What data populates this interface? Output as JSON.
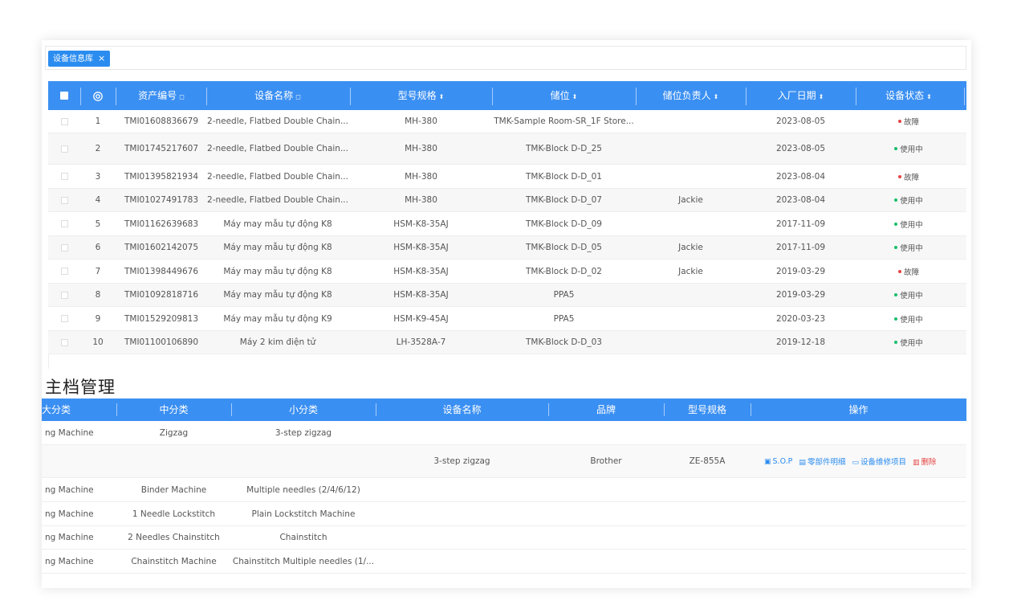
{
  "tabs": [
    {
      "label": "设备信息库",
      "close": "×"
    }
  ],
  "colors": {
    "header": "#3a8ff2",
    "tab": "#2b8cf0",
    "fault": "#e64242",
    "in_use": "#19be6b"
  },
  "table1": {
    "headers": {
      "asset_no": "资产编号",
      "name": "设备名称",
      "model": "型号规格",
      "location": "储位",
      "owner": "储位负责人",
      "date": "入厂日期",
      "status": "设备状态"
    },
    "rows": [
      {
        "idx": "1",
        "asset_no": "TMI01608836679",
        "name": "2-needle, Flatbed Double Chain...",
        "model": "MH-380",
        "location": "TMK-Sample Room-SR_1F Store...",
        "owner": "",
        "date": "2023-08-05",
        "status": "故障",
        "status_type": "fault"
      },
      {
        "idx": "2",
        "asset_no": "TMI01745217607",
        "name": "2-needle, Flatbed Double Chain...",
        "model": "MH-380",
        "location": "TMK-Block D-D_25",
        "owner": "",
        "date": "2023-08-05",
        "status": "使用中",
        "status_type": "in_use"
      },
      {
        "idx": "3",
        "asset_no": "TMI01395821934",
        "name": "2-needle, Flatbed Double Chain...",
        "model": "MH-380",
        "location": "TMK-Block D-D_01",
        "owner": "",
        "date": "2023-08-04",
        "status": "故障",
        "status_type": "fault"
      },
      {
        "idx": "4",
        "asset_no": "TMI01027491783",
        "name": "2-needle, Flatbed Double Chain...",
        "model": "MH-380",
        "location": "TMK-Block D-D_07",
        "owner": "Jackie",
        "date": "2023-08-04",
        "status": "使用中",
        "status_type": "in_use"
      },
      {
        "idx": "5",
        "asset_no": "TMI01162639683",
        "name": "Máy may mẫu tự động K8",
        "model": "HSM-K8-35AJ",
        "location": "TMK-Block D-D_09",
        "owner": "",
        "date": "2017-11-09",
        "status": "使用中",
        "status_type": "in_use"
      },
      {
        "idx": "6",
        "asset_no": "TMI01602142075",
        "name": "Máy may mẫu tự động K8",
        "model": "HSM-K8-35AJ",
        "location": "TMK-Block D-D_05",
        "owner": "Jackie",
        "date": "2017-11-09",
        "status": "使用中",
        "status_type": "in_use"
      },
      {
        "idx": "7",
        "asset_no": "TMI01398449676",
        "name": "Máy may mẫu tự động K8",
        "model": "HSM-K8-35AJ",
        "location": "TMK-Block D-D_02",
        "owner": "Jackie",
        "date": "2019-03-29",
        "status": "故障",
        "status_type": "fault"
      },
      {
        "idx": "8",
        "asset_no": "TMI01092818716",
        "name": "Máy may mẫu tự động K8",
        "model": "HSM-K8-35AJ",
        "location": "PPA5",
        "owner": "",
        "date": "2019-03-29",
        "status": "使用中",
        "status_type": "in_use"
      },
      {
        "idx": "9",
        "asset_no": "TMI01529209813",
        "name": "Máy may mẫu tự động K9",
        "model": "HSM-K9-45AJ",
        "location": "PPA5",
        "owner": "",
        "date": "2020-03-23",
        "status": "使用中",
        "status_type": "in_use"
      },
      {
        "idx": "10",
        "asset_no": "TMI01100106890",
        "name": "Máy 2 kim điện tử",
        "model": "LH-3528A-7",
        "location": "TMK-Block D-D_03",
        "owner": "",
        "date": "2019-12-18",
        "status": "使用中",
        "status_type": "in_use"
      }
    ]
  },
  "section_title": "主档管理",
  "table2": {
    "headers": {
      "major": "大分类",
      "mid": "中分类",
      "minor": "小分类",
      "name": "设备名称",
      "brand": "品牌",
      "model": "型号规格",
      "ops": "操作"
    },
    "ops": {
      "sop": "S.O.P",
      "parts": "零部件明细",
      "repair": "设备维修项目",
      "delete": "删除"
    },
    "rows": [
      {
        "major": "ng Machine",
        "mid": "Zigzag",
        "minor": "3-step zigzag",
        "name": "",
        "brand": "",
        "model": "",
        "has_ops": false
      },
      {
        "major": "",
        "mid": "",
        "minor": "",
        "name": "3-step zigzag",
        "brand": "Brother",
        "model": "ZE-855A",
        "has_ops": true
      },
      {
        "major": "ng Machine",
        "mid": "Binder Machine",
        "minor": "Multiple needles (2/4/6/12)",
        "name": "",
        "brand": "",
        "model": "",
        "has_ops": false
      },
      {
        "major": "ng Machine",
        "mid": "1 Needle Lockstitch",
        "minor": "Plain Lockstitch Machine",
        "name": "",
        "brand": "",
        "model": "",
        "has_ops": false
      },
      {
        "major": "ng Machine",
        "mid": "2 Needles Chainstitch",
        "minor": "Chainstitch",
        "name": "",
        "brand": "",
        "model": "",
        "has_ops": false
      },
      {
        "major": "ng Machine",
        "mid": "Chainstitch Machine",
        "minor": "Chainstitch Multiple needles (1/...",
        "name": "",
        "brand": "",
        "model": "",
        "has_ops": false
      }
    ]
  }
}
